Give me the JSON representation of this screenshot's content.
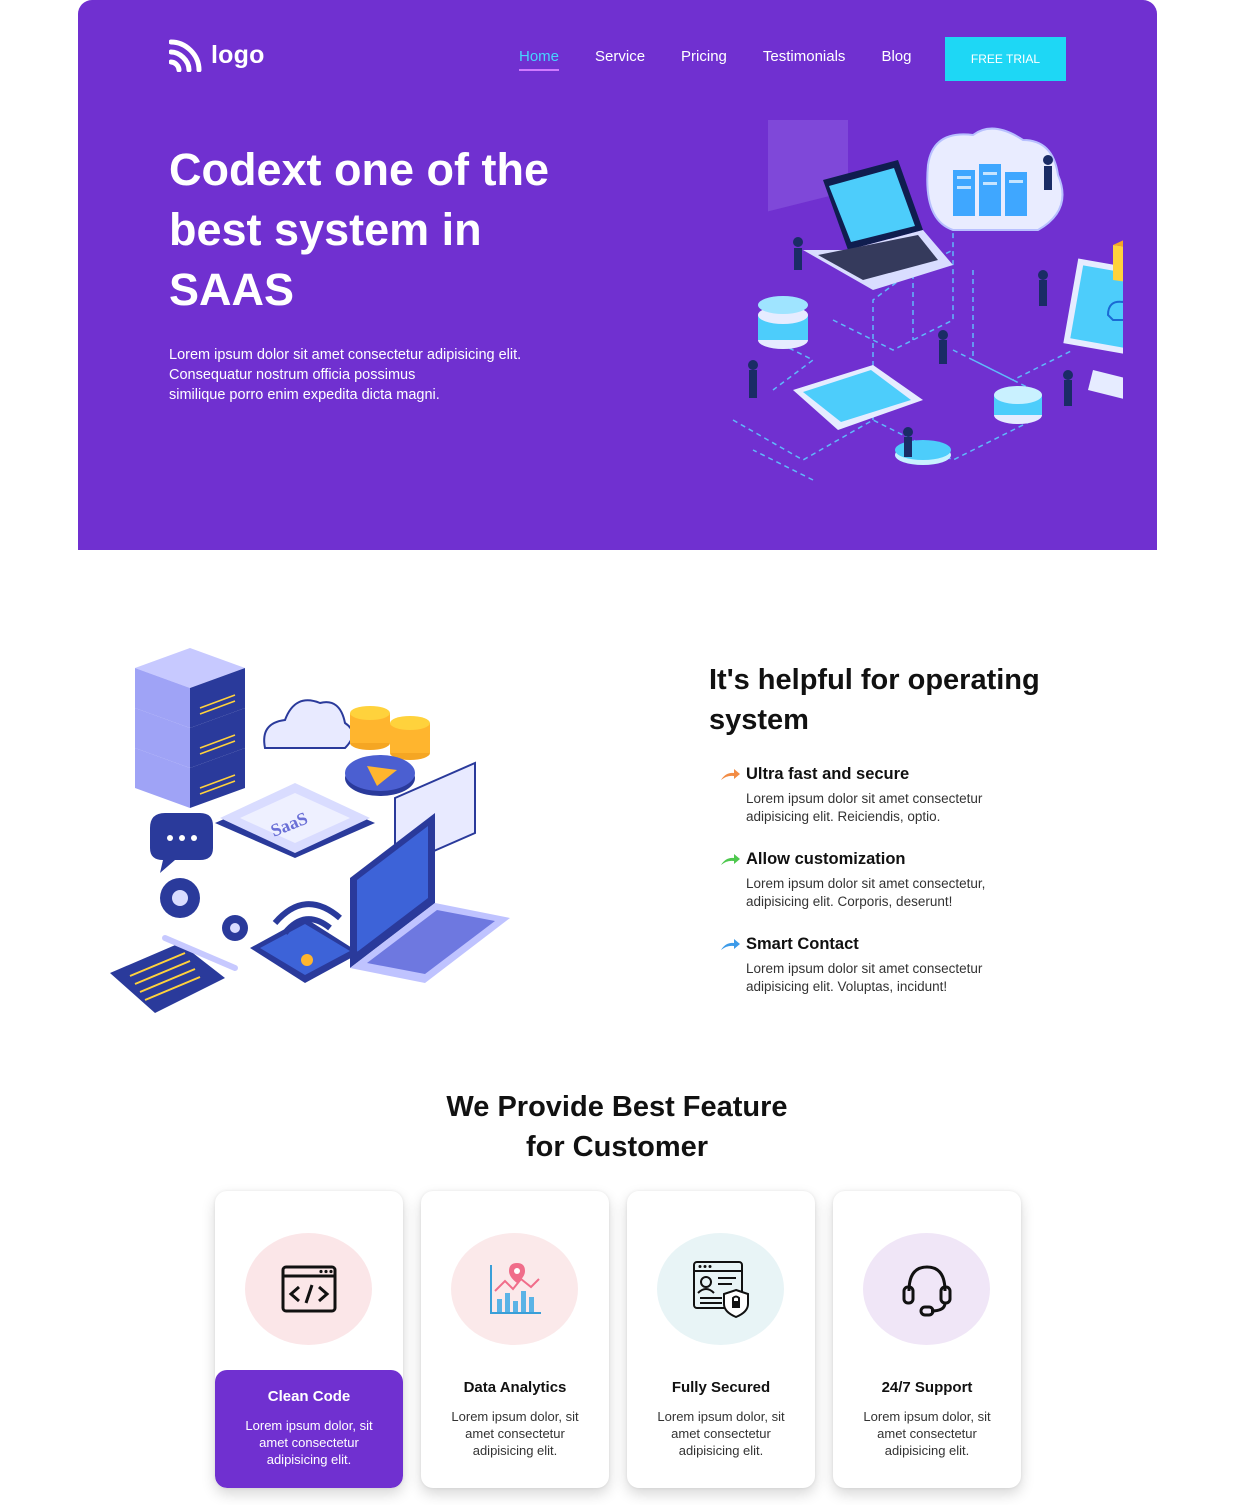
{
  "colors": {
    "brand": "#7030d0",
    "accent": "#1ed7f5",
    "active_nav": "#46d5ff"
  },
  "header": {
    "logo_text": "logo",
    "nav": [
      "Home",
      "Service",
      "Pricing",
      "Testimonials",
      "Blog"
    ],
    "cta": "FREE TRIAL"
  },
  "hero": {
    "title": "Codext one of the best system in SAAS",
    "desc_lines": [
      "Lorem ipsum dolor sit amet consectetur adipisicing elit.",
      "Consequatur nostrum officia possimus",
      "similique porro enim expedita dicta magni."
    ]
  },
  "about": {
    "title": "It's helpful for operating system",
    "items": [
      {
        "title": "Ultra fast and secure",
        "desc": "Lorem ipsum dolor sit amet consectetur adipisicing elit. Reiciendis, optio.",
        "arrow_color": "#f28c45"
      },
      {
        "title": "Allow customization",
        "desc": "Lorem ipsum dolor sit amet consectetur, adipisicing elit. Corporis, deserunt!",
        "arrow_color": "#4ec84e"
      },
      {
        "title": "Smart Contact",
        "desc": "Lorem ipsum dolor sit amet consectetur adipisicing elit. Voluptas, incidunt!",
        "arrow_color": "#3d9be9"
      }
    ]
  },
  "features": {
    "title_line1": "We Provide Best Feature",
    "title_line2": "for Customer",
    "cards": [
      {
        "title": "Clean Code",
        "desc": "Lorem ipsum dolor, sit amet consectetur adipisicing elit.",
        "icon": "code-window-icon",
        "circle_color": "#fbe6e8"
      },
      {
        "title": "Data Analytics",
        "desc": "Lorem ipsum dolor, sit amet consectetur adipisicing elit.",
        "icon": "analytics-chart-icon",
        "circle_color": "#fbe9ea"
      },
      {
        "title": "Fully Secured",
        "desc": "Lorem ipsum dolor, sit amet consectetur adipisicing elit.",
        "icon": "secure-profile-icon",
        "circle_color": "#e8f4f6"
      },
      {
        "title": "24/7 Support",
        "desc": "Lorem ipsum dolor, sit amet consectetur adipisicing elit.",
        "icon": "headset-icon",
        "circle_color": "#f0e6f7"
      }
    ]
  }
}
